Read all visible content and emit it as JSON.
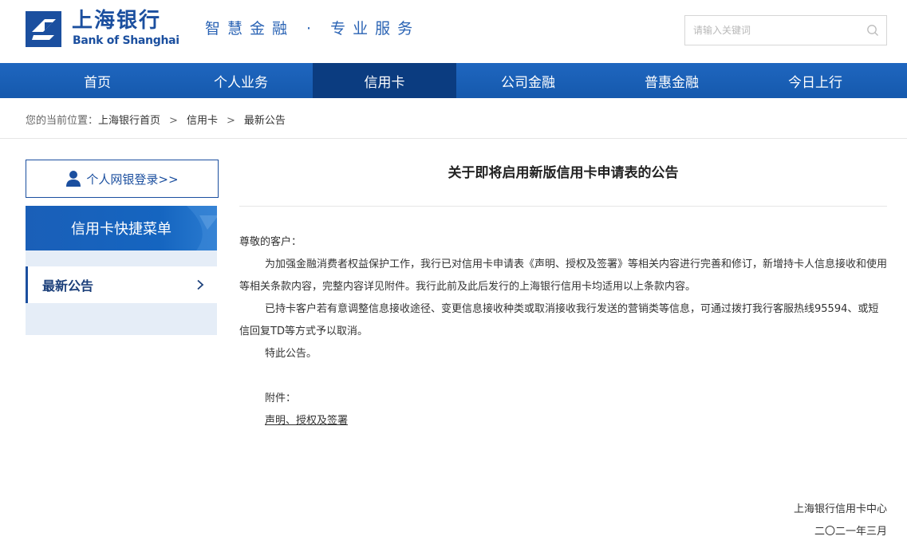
{
  "header": {
    "logo_cn": "上海银行",
    "logo_en": "Bank of Shanghai",
    "slogan": "智慧金融 · 专业服务",
    "search_placeholder": "请输入关键词"
  },
  "nav": {
    "items": [
      {
        "label": "首页"
      },
      {
        "label": "个人业务"
      },
      {
        "label": "信用卡"
      },
      {
        "label": "公司金融"
      },
      {
        "label": "普惠金融"
      },
      {
        "label": "今日上行"
      }
    ],
    "active": "信用卡"
  },
  "breadcrumb": {
    "prefix": "您的当前位置：",
    "items": [
      "上海银行首页",
      "信用卡",
      "最新公告"
    ],
    "separator": ">"
  },
  "sidebar": {
    "login_label": "个人网银登录>>",
    "menu_title": "信用卡快捷菜单",
    "menu_items": [
      {
        "label": "最新公告"
      }
    ]
  },
  "article": {
    "title": "关于即将启用新版信用卡申请表的公告",
    "salutation": "尊敬的客户：",
    "paragraphs": [
      "为加强金融消费者权益保护工作，我行已对信用卡申请表《声明、授权及签署》等相关内容进行完善和修订，新增持卡人信息接收和使用等相关条款内容，完整内容详见附件。我行此前及此后发行的上海银行信用卡均适用以上条款内容。",
      "已持卡客户若有意调整信息接收途径、变更信息接收种类或取消接收我行发送的营销类等信息，可通过拨打我行客服热线95594、或短信回复TD等方式予以取消。",
      "特此公告。"
    ],
    "attachment_label": "附件：",
    "attachment_link": "声明、授权及签署",
    "signature_org": "上海银行信用卡中心",
    "signature_date": "二〇二一年三月"
  },
  "colors": {
    "brand": "#1b4f9f",
    "nav_bg": "#1a5fb8",
    "nav_active": "#0b3c80",
    "menu_bg": "#e5edf7"
  }
}
